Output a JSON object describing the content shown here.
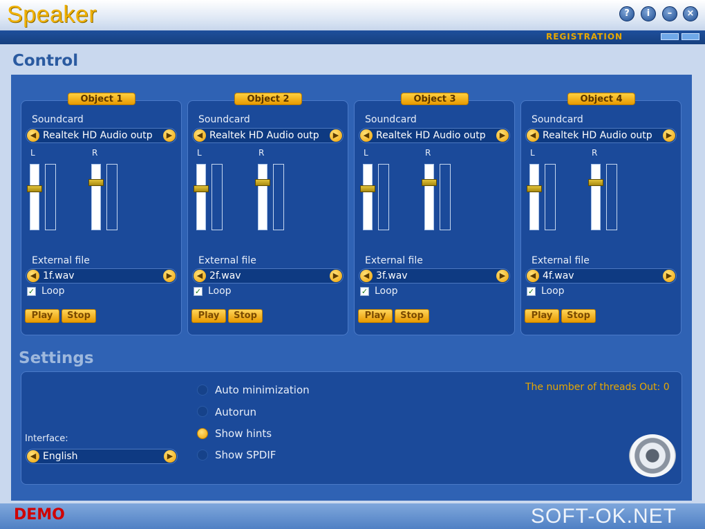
{
  "window": {
    "title": "Speaker",
    "buttons": {
      "help": "?",
      "info": "i",
      "minimize": "–",
      "close": "×"
    },
    "registration_label": "REGISTRATION"
  },
  "control": {
    "title": "Control",
    "objects": [
      {
        "title": "Object  1",
        "soundcard_label": "Soundcard",
        "soundcard_value": "Realtek HD Audio outp",
        "left_label": "L",
        "right_label": "R",
        "left_volume": 0.62,
        "right_volume": 0.72,
        "external_file_label": "External file",
        "file_value": "1f.wav",
        "loop_label": "Loop",
        "loop_checked": true,
        "play_label": "Play",
        "stop_label": "Stop"
      },
      {
        "title": "Object  2",
        "soundcard_label": "Soundcard",
        "soundcard_value": "Realtek HD Audio outp",
        "left_label": "L",
        "right_label": "R",
        "left_volume": 0.62,
        "right_volume": 0.72,
        "external_file_label": "External file",
        "file_value": "2f.wav",
        "loop_label": "Loop",
        "loop_checked": true,
        "play_label": "Play",
        "stop_label": "Stop"
      },
      {
        "title": "Object  3",
        "soundcard_label": "Soundcard",
        "soundcard_value": "Realtek HD Audio outp",
        "left_label": "L",
        "right_label": "R",
        "left_volume": 0.62,
        "right_volume": 0.72,
        "external_file_label": "External file",
        "file_value": "3f.wav",
        "loop_label": "Loop",
        "loop_checked": true,
        "play_label": "Play",
        "stop_label": "Stop"
      },
      {
        "title": "Object  4",
        "soundcard_label": "Soundcard",
        "soundcard_value": "Realtek HD Audio outp",
        "left_label": "L",
        "right_label": "R",
        "left_volume": 0.62,
        "right_volume": 0.72,
        "external_file_label": "External file",
        "file_value": "4f.wav",
        "loop_label": "Loop",
        "loop_checked": true,
        "play_label": "Play",
        "stop_label": "Stop"
      }
    ]
  },
  "settings": {
    "title": "Settings",
    "interface_label": "Interface:",
    "interface_value": "English",
    "options": [
      {
        "label": "Auto minimization",
        "selected": false
      },
      {
        "label": "Autorun",
        "selected": false
      },
      {
        "label": "Show hints",
        "selected": true
      },
      {
        "label": "Show SPDIF",
        "selected": false
      }
    ],
    "threads_text": "The number of threads Out: 0"
  },
  "statusbar": {
    "demo_label": "DEMO",
    "watermark": "SOFT-OK.NET"
  },
  "colors": {
    "accent": "#f0b000",
    "panel": "#1b4a9a",
    "background": "#2f62b4",
    "demo": "#d00000"
  },
  "icons": {
    "speaker": "speaker-icon",
    "left_arrow": "arrow-left-icon",
    "right_arrow": "arrow-right-icon"
  }
}
